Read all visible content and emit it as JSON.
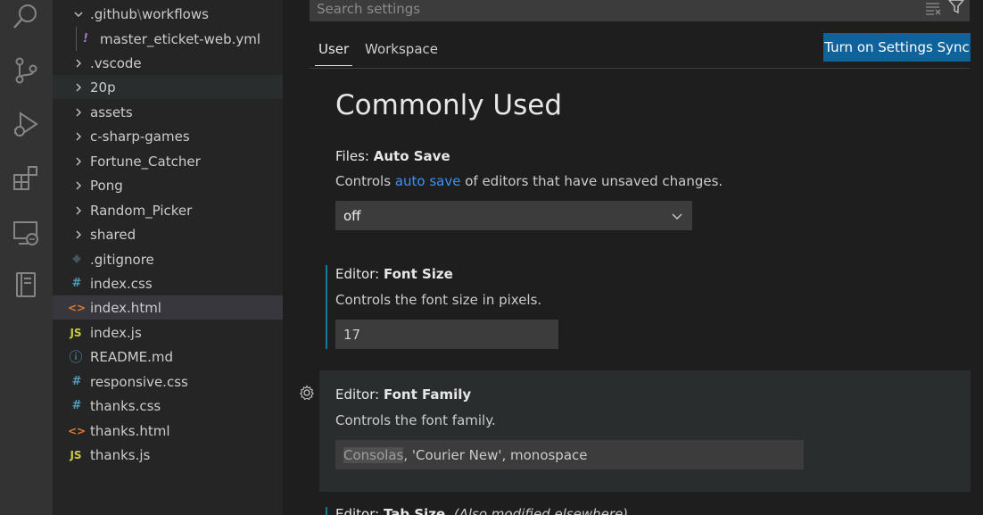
{
  "activity_bar": {
    "icons": [
      "search-icon",
      "source-control-icon",
      "run-debug-icon",
      "extensions-icon",
      "remote-explorer-icon",
      "notebook-icon"
    ]
  },
  "explorer": {
    "items": [
      {
        "label": ".github",
        "label_sep": "\\",
        "label_tail": "workflows",
        "type": "folder-open"
      },
      {
        "label": "master_eticket-web.yml",
        "type": "yml",
        "icon_text": "!"
      },
      {
        "label": ".vscode",
        "type": "folder"
      },
      {
        "label": "20p",
        "type": "folder"
      },
      {
        "label": "assets",
        "type": "folder"
      },
      {
        "label": "c-sharp-games",
        "type": "folder"
      },
      {
        "label": "Fortune_Catcher",
        "type": "folder"
      },
      {
        "label": "Pong",
        "type": "folder"
      },
      {
        "label": "Random_Picker",
        "type": "folder"
      },
      {
        "label": "shared",
        "type": "folder"
      },
      {
        "label": ".gitignore",
        "type": "git"
      },
      {
        "label": "index.css",
        "type": "css",
        "icon_text": "#"
      },
      {
        "label": "index.html",
        "type": "html",
        "icon_text": "<>"
      },
      {
        "label": "index.js",
        "type": "js",
        "icon_text": "JS"
      },
      {
        "label": "README.md",
        "type": "info",
        "icon_text": "ⓘ"
      },
      {
        "label": "responsive.css",
        "type": "css",
        "icon_text": "#"
      },
      {
        "label": "thanks.css",
        "type": "css",
        "icon_text": "#"
      },
      {
        "label": "thanks.html",
        "type": "html",
        "icon_text": "<>"
      },
      {
        "label": "thanks.js",
        "type": "js",
        "icon_text": "JS"
      }
    ]
  },
  "settings": {
    "search_placeholder": "Search settings",
    "tabs": {
      "user": "User",
      "workspace": "Workspace"
    },
    "sync_button": "Turn on Settings Sync",
    "heading": "Commonly Used",
    "auto_save": {
      "category": "Files: ",
      "name": "Auto Save",
      "desc_pre": "Controls ",
      "desc_link": "auto save",
      "desc_post": " of editors that have unsaved changes.",
      "value": "off"
    },
    "font_size": {
      "category": "Editor: ",
      "name": "Font Size",
      "desc": "Controls the font size in pixels.",
      "value": "17"
    },
    "font_family": {
      "category": "Editor: ",
      "name": "Font Family",
      "desc": "Controls the font family.",
      "value_highlight": "Consolas",
      "value_rest": ", 'Courier New', monospace"
    },
    "tab_size": {
      "category": "Editor: ",
      "name": "Tab Size",
      "note": "(Also modified elsewhere)"
    }
  },
  "colors": {
    "accent_button": "#0e639c",
    "link": "#3794ff",
    "modified_indicator": "#0c7d9d",
    "js_icon": "#cbcb41",
    "css_icon": "#519aba",
    "html_icon": "#e37933",
    "yml_icon": "#a074c4"
  }
}
